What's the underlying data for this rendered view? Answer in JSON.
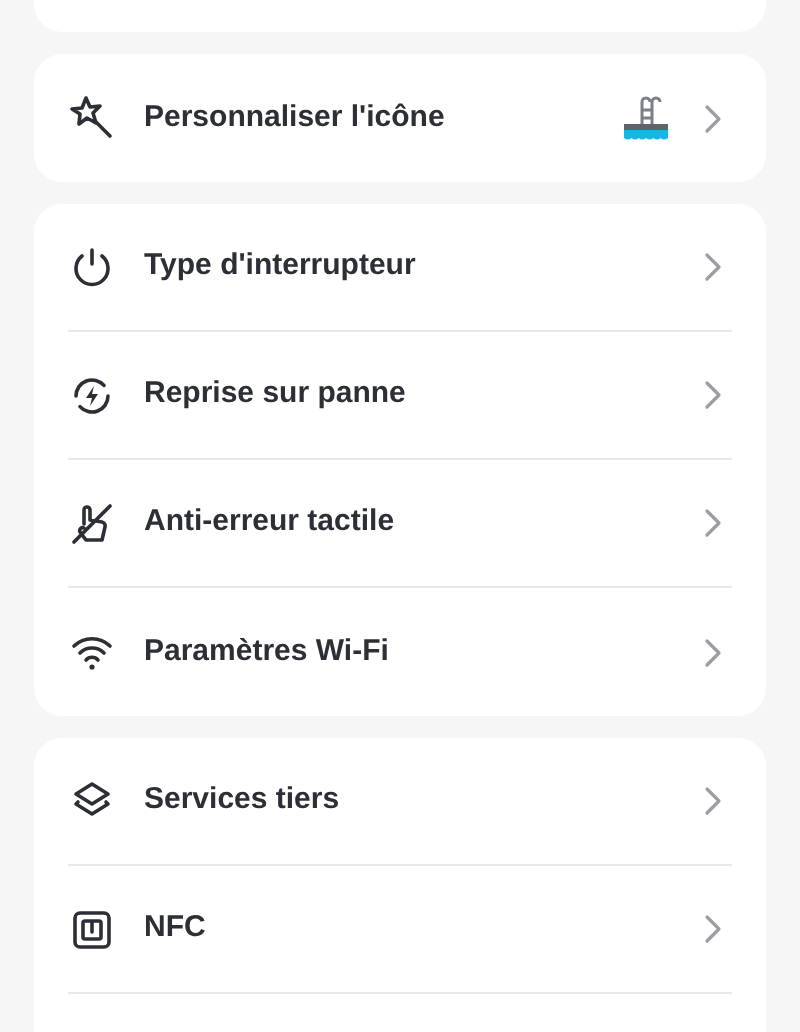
{
  "groups": [
    {
      "items": [
        {
          "kind": "preview",
          "label": "Personnaliser l'icône"
        }
      ]
    },
    {
      "items": [
        {
          "kind": "link",
          "label": "Type d'interrupteur"
        },
        {
          "kind": "link",
          "label": "Reprise sur panne"
        },
        {
          "kind": "link",
          "label": "Anti-erreur tactile"
        },
        {
          "kind": "link",
          "label": "Paramètres Wi-Fi"
        }
      ]
    },
    {
      "items": [
        {
          "kind": "link",
          "label": "Services tiers"
        },
        {
          "kind": "link",
          "label": "NFC"
        }
      ]
    }
  ]
}
